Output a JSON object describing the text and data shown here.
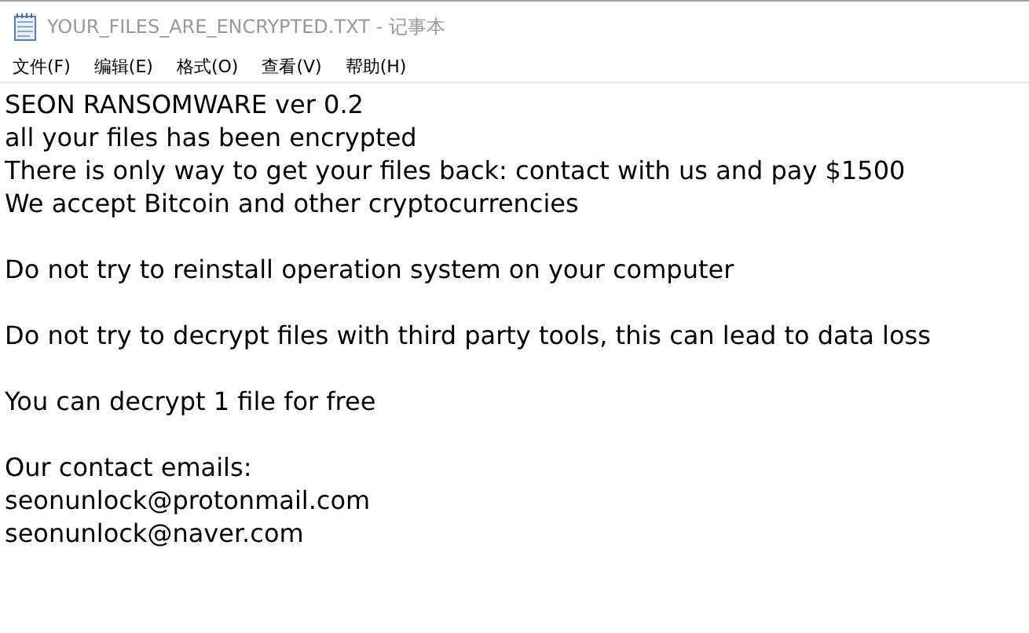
{
  "window": {
    "title": "YOUR_FILES_ARE_ENCRYPTED.TXT - 记事本",
    "active": false
  },
  "menu": [
    {
      "label": "文件(F)"
    },
    {
      "label": "编辑(E)"
    },
    {
      "label": "格式(O)"
    },
    {
      "label": "查看(V)"
    },
    {
      "label": "帮助(H)"
    }
  ],
  "document": {
    "paragraphs": [
      [
        "SEON RANSOMWARE ver 0.2",
        "all your files has been encrypted",
        "There is only way to get your files back: contact with us and pay $1500",
        "We accept Bitcoin and other cryptocurrencies"
      ],
      [
        "Do not try to reinstall operation system on your computer"
      ],
      [
        "Do not try to decrypt files with third party tools, this can lead to data loss"
      ],
      [
        "You can decrypt 1 file for free"
      ],
      [
        "Our contact emails:",
        "seonunlock@protonmail.com",
        "seonunlock@naver.com"
      ]
    ]
  }
}
